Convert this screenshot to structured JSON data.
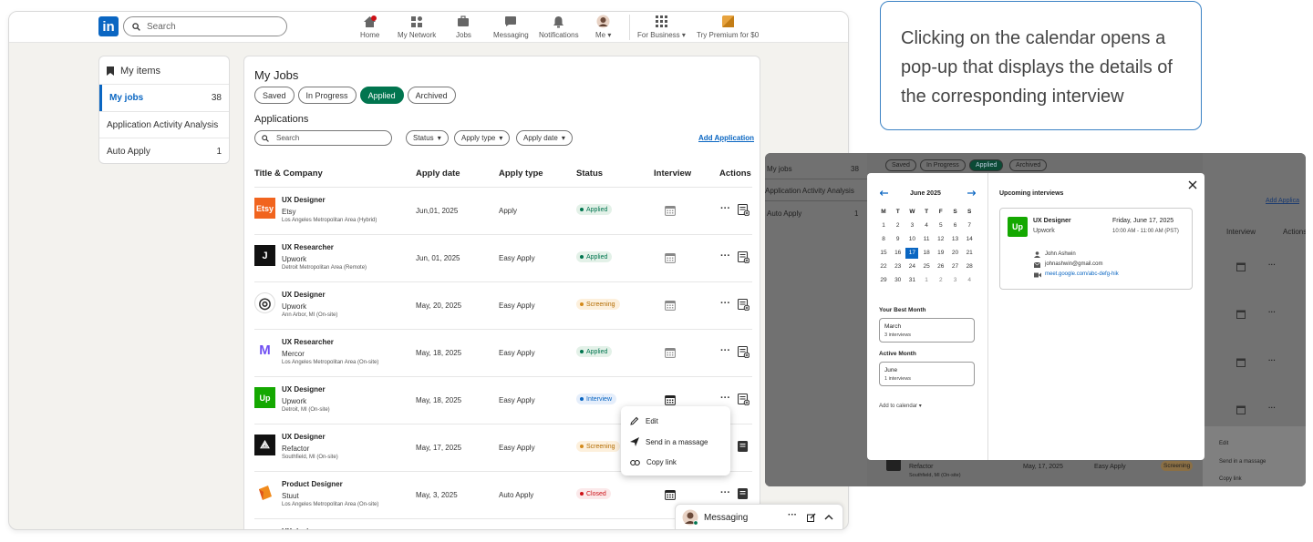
{
  "topnav": {
    "logo": "in",
    "search_placeholder": "Search",
    "items": [
      {
        "label": "Home",
        "icon": "home-icon"
      },
      {
        "label": "My Network",
        "icon": "network-icon"
      },
      {
        "label": "Jobs",
        "icon": "briefcase-icon"
      },
      {
        "label": "Messaging",
        "icon": "messaging-icon"
      },
      {
        "label": "Notifications",
        "icon": "bell-icon"
      },
      {
        "label": "Me",
        "icon": "avatar-icon"
      },
      {
        "label": "For Business",
        "icon": "grid-icon"
      },
      {
        "label": "Try Premium for $0",
        "icon": "premium-icon"
      }
    ]
  },
  "sidebar": {
    "header": "My items",
    "items": [
      {
        "label": "My jobs",
        "count": "38"
      },
      {
        "label": "Application Activity Analysis",
        "count": ""
      },
      {
        "label": "Auto Apply",
        "count": "1"
      }
    ]
  },
  "main": {
    "title": "My Jobs",
    "tabs": [
      "Saved",
      "In Progress",
      "Applied",
      "Archived"
    ],
    "active_tab": "Applied",
    "section_title": "Applications",
    "search_placeholder": "Search",
    "filters": [
      "Status",
      "Apply type",
      "Apply date"
    ],
    "add_link": "Add Application",
    "columns": [
      "Title & Company",
      "Apply date",
      "Apply type",
      "Status",
      "Interview",
      "Actions"
    ],
    "rows": [
      {
        "title": "UX Designer",
        "company": "Etsy",
        "location": "Los Angeles Metropolitan Area (Hybrid)",
        "date": "Jun,01, 2025",
        "type": "Apply",
        "status": "Applied",
        "logo": "Etsy"
      },
      {
        "title": "UX Researcher",
        "company": "Upwork",
        "location": "Detroit Metropolitan Area (Remote)",
        "date": "Jun, 01, 2025",
        "type": "Easy Apply",
        "status": "Applied",
        "logo": "J"
      },
      {
        "title": "UX Designer",
        "company": "Upwork",
        "location": "Ann Arbor, MI  (On-site)",
        "date": "May, 20, 2025",
        "type": "Easy Apply",
        "status": "Screening",
        "logo": "◎"
      },
      {
        "title": "UX Researcher",
        "company": "Mercor",
        "location": "Los Angeles Metropolitan Area (On-site)",
        "date": "May, 18, 2025",
        "type": "Easy Apply",
        "status": "Applied",
        "logo": "M"
      },
      {
        "title": "UX Designer",
        "company": "Upwork",
        "location": "Detroit, MI (On-site)",
        "date": "May, 18, 2025",
        "type": "Easy Apply",
        "status": "Interview",
        "logo": "Up"
      },
      {
        "title": "UX Designer",
        "company": "Refactor",
        "location": "Southfield, MI (On-site)",
        "date": "May, 17, 2025",
        "type": "Easy Apply",
        "status": "Screening",
        "logo": "⟁"
      },
      {
        "title": "Product Designer",
        "company": "Stuut",
        "location": "Los Angeles Metropolitan Area (On-site)",
        "date": "May, 3, 2025",
        "type": "Auto Apply",
        "status": "Closed",
        "logo": ""
      },
      {
        "title": "UX designer",
        "company": "",
        "location": "",
        "date": "",
        "type": "",
        "status": "",
        "logo": ""
      }
    ]
  },
  "context_menu": {
    "items": [
      {
        "label": "Edit",
        "icon": "pencil-icon"
      },
      {
        "label": "Send in a massage",
        "icon": "send-icon"
      },
      {
        "label": "Copy link",
        "icon": "link-icon"
      }
    ]
  },
  "messaging": {
    "label": "Messaging"
  },
  "callout": {
    "text": "Clicking on the calendar opens a pop-up that displays the details of the corresponding interview"
  },
  "popup": {
    "bg_pills": [
      "Saved",
      "In Progress",
      "Applied",
      "Archived"
    ],
    "bg_left": [
      "My jobs",
      "Application Activity Analysis",
      "Auto Apply"
    ],
    "bg_left_counts": [
      "38",
      "",
      "1"
    ],
    "bg_right": [
      "Add Applica",
      "Interview",
      "Actions"
    ],
    "bg_row": {
      "company": "Refactor",
      "location": "Southfield, MI (On-site)",
      "date": "May, 17, 2025",
      "type": "Easy Apply",
      "status": "Screening"
    },
    "bg_menu": [
      "Edit",
      "Send in a massage",
      "Copy link"
    ],
    "calendar": {
      "month": "June 2025",
      "weekdays": [
        "M",
        "T",
        "W",
        "T",
        "F",
        "S",
        "S"
      ],
      "weeks": [
        [
          "1",
          "2",
          "3",
          "4",
          "5",
          "6",
          "7"
        ],
        [
          "8",
          "9",
          "10",
          "11",
          "12",
          "13",
          "14"
        ],
        [
          "15",
          "16",
          "17",
          "18",
          "19",
          "20",
          "21"
        ],
        [
          "22",
          "23",
          "24",
          "25",
          "26",
          "27",
          "28"
        ],
        [
          "29",
          "30",
          "31",
          "1",
          "2",
          "3",
          "4"
        ]
      ],
      "selected": "17"
    },
    "best_month": {
      "title": "Your Best Month",
      "month": "March",
      "count": "3 interviews"
    },
    "active_month": {
      "title": "Active Month",
      "month": "June",
      "count": "1 interviews"
    },
    "add_to_calendar": "Add to calendar",
    "upcoming_title": "Upcoming interviews",
    "interview": {
      "role": "UX Designer",
      "company": "Upwork",
      "date": "Friday, June 17, 2025",
      "time": "10:00 AM - 11:00 AM (PST)",
      "person": "John Ashwin",
      "email": "johnashwin@gmail.com",
      "link": "meet.google.com/abc-defg-hik"
    }
  },
  "colors": {
    "brand": "#0a66c2",
    "applied": "#01754f",
    "screening": "#c37d16",
    "interview": "#0a66c2",
    "closed": "#cc1016"
  }
}
